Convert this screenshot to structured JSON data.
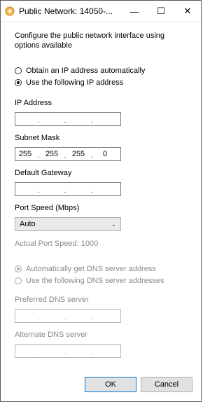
{
  "window": {
    "title": "Public Network: 14050-...",
    "minimize_glyph": "—",
    "maximize_glyph": "☐",
    "close_glyph": "✕"
  },
  "description": "Configure the public network interface using options available",
  "ip_mode": {
    "auto_label": "Obtain an IP address automatically",
    "manual_label": "Use the following IP address",
    "selected": "manual"
  },
  "ip_address": {
    "label": "IP Address",
    "octets": [
      "",
      "",
      "",
      ""
    ]
  },
  "subnet_mask": {
    "label": "Subnet Mask",
    "octets": [
      "255",
      "255",
      "255",
      "0"
    ]
  },
  "default_gateway": {
    "label": "Default Gateway",
    "octets": [
      "",
      "",
      "",
      ""
    ]
  },
  "port_speed": {
    "label": "Port Speed (Mbps)",
    "selected": "Auto",
    "actual_label": "Actual Port Speed:",
    "actual_value": "1000"
  },
  "dns_mode": {
    "auto_label": "Automatically get DNS server address",
    "manual_label": "Use the following DNS server addresses",
    "selected": "auto",
    "disabled": true
  },
  "preferred_dns": {
    "label": "Preferred DNS server",
    "octets": [
      "",
      "",
      "",
      ""
    ]
  },
  "alternate_dns": {
    "label": "Alternate DNS server",
    "octets": [
      "",
      "",
      "",
      ""
    ]
  },
  "buttons": {
    "ok": "OK",
    "cancel": "Cancel"
  },
  "colors": {
    "default_button_border": "#0078d7",
    "disabled_text": "#8a8a8a"
  }
}
